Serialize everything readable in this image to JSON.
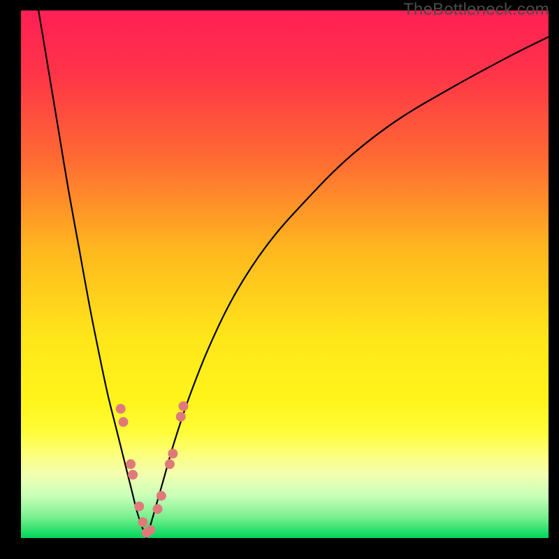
{
  "watermark": "TheBottleneck.com",
  "chart_data": {
    "type": "line",
    "title": "",
    "xlabel": "",
    "ylabel": "",
    "xlim": [
      0,
      100
    ],
    "ylim": [
      0,
      100
    ],
    "series": [
      {
        "name": "left-curve",
        "x": [
          3,
          5,
          7,
          9,
          11,
          13,
          15,
          16.5,
          18,
          19.5,
          21,
          22,
          23,
          23.8
        ],
        "y": [
          102,
          90,
          78,
          66,
          55,
          44,
          34,
          27,
          21,
          15,
          9,
          5,
          2,
          0
        ]
      },
      {
        "name": "right-curve",
        "x": [
          23.8,
          25,
          27,
          29,
          32,
          36,
          41,
          47,
          54,
          62,
          71,
          81,
          92,
          100
        ],
        "y": [
          0,
          4,
          11,
          18,
          27,
          37,
          47,
          56,
          64,
          72,
          79,
          85,
          91,
          95
        ]
      }
    ],
    "markers": {
      "name": "data-points",
      "color": "#e07a7a",
      "points_x": [
        18.9,
        19.4,
        20.8,
        21.2,
        22.4,
        23.1,
        23.8,
        24.5,
        25.9,
        26.6,
        28.2,
        28.8,
        30.3,
        30.8
      ],
      "points_y": [
        24.5,
        22,
        14,
        12,
        6,
        3,
        1,
        1.5,
        5.5,
        8,
        14,
        16,
        23,
        25
      ],
      "radius": 7
    },
    "gradient_stops": [
      {
        "offset": 0.0,
        "color": "#ff1f55"
      },
      {
        "offset": 0.12,
        "color": "#ff3448"
      },
      {
        "offset": 0.28,
        "color": "#ff6a33"
      },
      {
        "offset": 0.45,
        "color": "#ffb61f"
      },
      {
        "offset": 0.62,
        "color": "#ffe619"
      },
      {
        "offset": 0.74,
        "color": "#fff51a"
      },
      {
        "offset": 0.8,
        "color": "#fffc3a"
      },
      {
        "offset": 0.84,
        "color": "#fdff7a"
      },
      {
        "offset": 0.88,
        "color": "#f2ffb0"
      },
      {
        "offset": 0.92,
        "color": "#c9ffb8"
      },
      {
        "offset": 0.96,
        "color": "#7af08f"
      },
      {
        "offset": 1.0,
        "color": "#00d65a"
      }
    ]
  }
}
